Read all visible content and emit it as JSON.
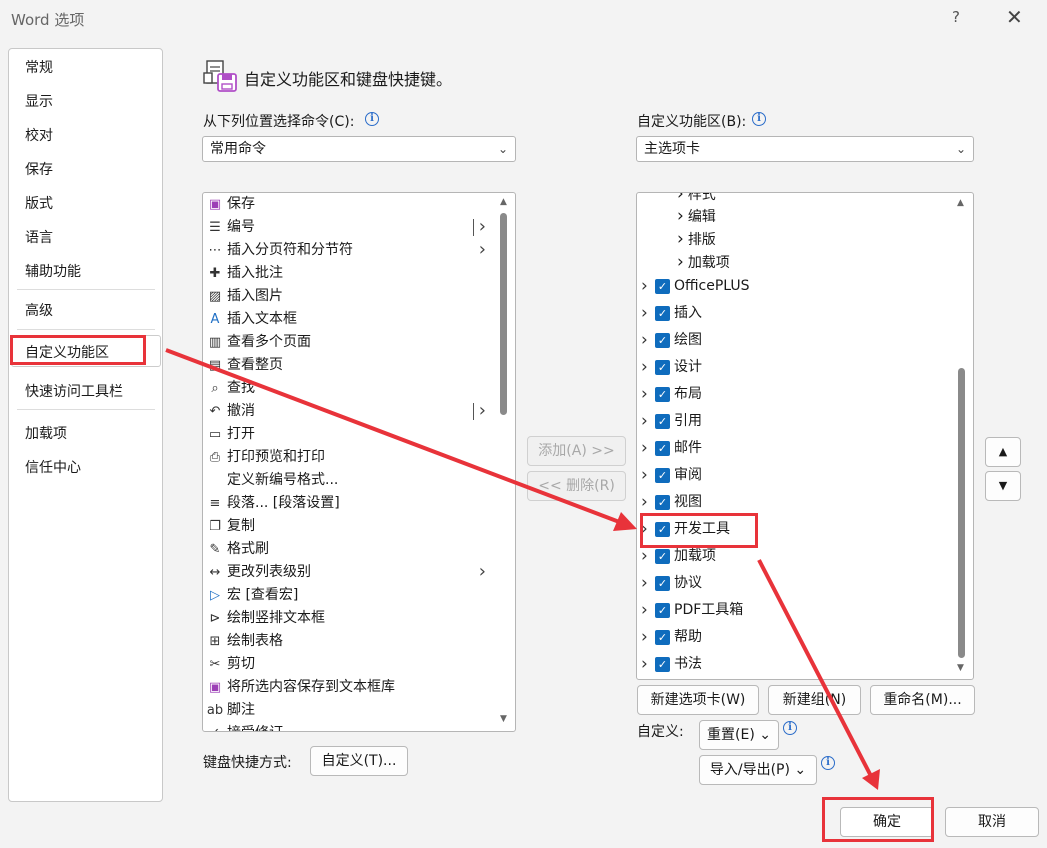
{
  "window": {
    "title": "Word 选项",
    "help": "?",
    "close": "✕"
  },
  "nav": {
    "items": [
      "常规",
      "显示",
      "校对",
      "保存",
      "版式",
      "语言",
      "辅助功能",
      "高级",
      "自定义功能区",
      "快速访问工具栏",
      "加载项",
      "信任中心"
    ],
    "selected": "自定义功能区"
  },
  "header": {
    "title": "自定义功能区和键盘快捷键。"
  },
  "choose": {
    "label": "从下列位置选择命令(C):",
    "value": "常用命令"
  },
  "commands": [
    {
      "icon": "save-icon",
      "glyph": "▣",
      "label": "保存"
    },
    {
      "icon": "numbering-icon",
      "glyph": "☰",
      "label": "编号",
      "split": true
    },
    {
      "icon": "page-break-icon",
      "glyph": "⋯",
      "label": "插入分页符和分节符",
      "sub": true
    },
    {
      "icon": "comment-icon",
      "glyph": "✚",
      "label": "插入批注"
    },
    {
      "icon": "picture-icon",
      "glyph": "▨",
      "label": "插入图片"
    },
    {
      "icon": "textbox-icon",
      "glyph": "A",
      "label": "插入文本框"
    },
    {
      "icon": "multi-page-icon",
      "glyph": "▥",
      "label": "查看多个页面"
    },
    {
      "icon": "one-page-icon",
      "glyph": "▤",
      "label": "查看整页"
    },
    {
      "icon": "find-icon",
      "glyph": "⌕",
      "label": "查找"
    },
    {
      "icon": "undo-icon",
      "glyph": "↶",
      "label": "撤消",
      "split": true
    },
    {
      "icon": "open-icon",
      "glyph": "▭",
      "label": "打开"
    },
    {
      "icon": "print-preview-icon",
      "glyph": "⎙",
      "label": "打印预览和打印"
    },
    {
      "icon": "",
      "glyph": "",
      "label": "定义新编号格式..."
    },
    {
      "icon": "paragraph-icon",
      "glyph": "≡",
      "label": "段落... [段落设置]"
    },
    {
      "icon": "copy-icon",
      "glyph": "❐",
      "label": "复制"
    },
    {
      "icon": "format-painter-icon",
      "glyph": "✎",
      "label": "格式刷"
    },
    {
      "icon": "list-level-icon",
      "glyph": "↔",
      "label": "更改列表级别",
      "sub": true
    },
    {
      "icon": "macro-icon",
      "glyph": "▷",
      "label": "宏 [查看宏]"
    },
    {
      "icon": "vertical-textbox-icon",
      "glyph": "⊳",
      "label": "绘制竖排文本框"
    },
    {
      "icon": "draw-table-icon",
      "glyph": "⊞",
      "label": "绘制表格"
    },
    {
      "icon": "cut-icon",
      "glyph": "✂",
      "label": "剪切"
    },
    {
      "icon": "save-selection-icon",
      "glyph": "▣",
      "label": "将所选内容保存到文本框库"
    },
    {
      "icon": "footnote-icon",
      "glyph": "ab",
      "label": "脚注"
    },
    {
      "icon": "accept-change-icon",
      "glyph": "✓",
      "label": "接受修订"
    }
  ],
  "ribbon": {
    "label": "自定义功能区(B):",
    "value": "主选项卡"
  },
  "groups": [
    "样式",
    "编辑",
    "排版",
    "加载项"
  ],
  "tabs": [
    "OfficePLUS",
    "插入",
    "绘图",
    "设计",
    "布局",
    "引用",
    "邮件",
    "审阅",
    "视图",
    "开发工具",
    "加载项",
    "协议",
    "PDF工具箱",
    "帮助",
    "书法"
  ],
  "buttons": {
    "add": "添加(A) >>",
    "remove": "<< 删除(R)",
    "new_tab": "新建选项卡(W)",
    "new_group": "新建组(N)",
    "rename": "重命名(M)...",
    "customize_label": "自定义:",
    "reset": "重置(E) ⌄",
    "import_export": "导入/导出(P) ⌄",
    "keyboard_label": "键盘快捷方式:",
    "keyboard_customize": "自定义(T)...",
    "ok": "确定",
    "cancel": "取消",
    "move_up": "▲",
    "move_down": "▼"
  },
  "colors": {
    "annotation": "#e8333a",
    "checkbox": "#0f6cbd"
  }
}
